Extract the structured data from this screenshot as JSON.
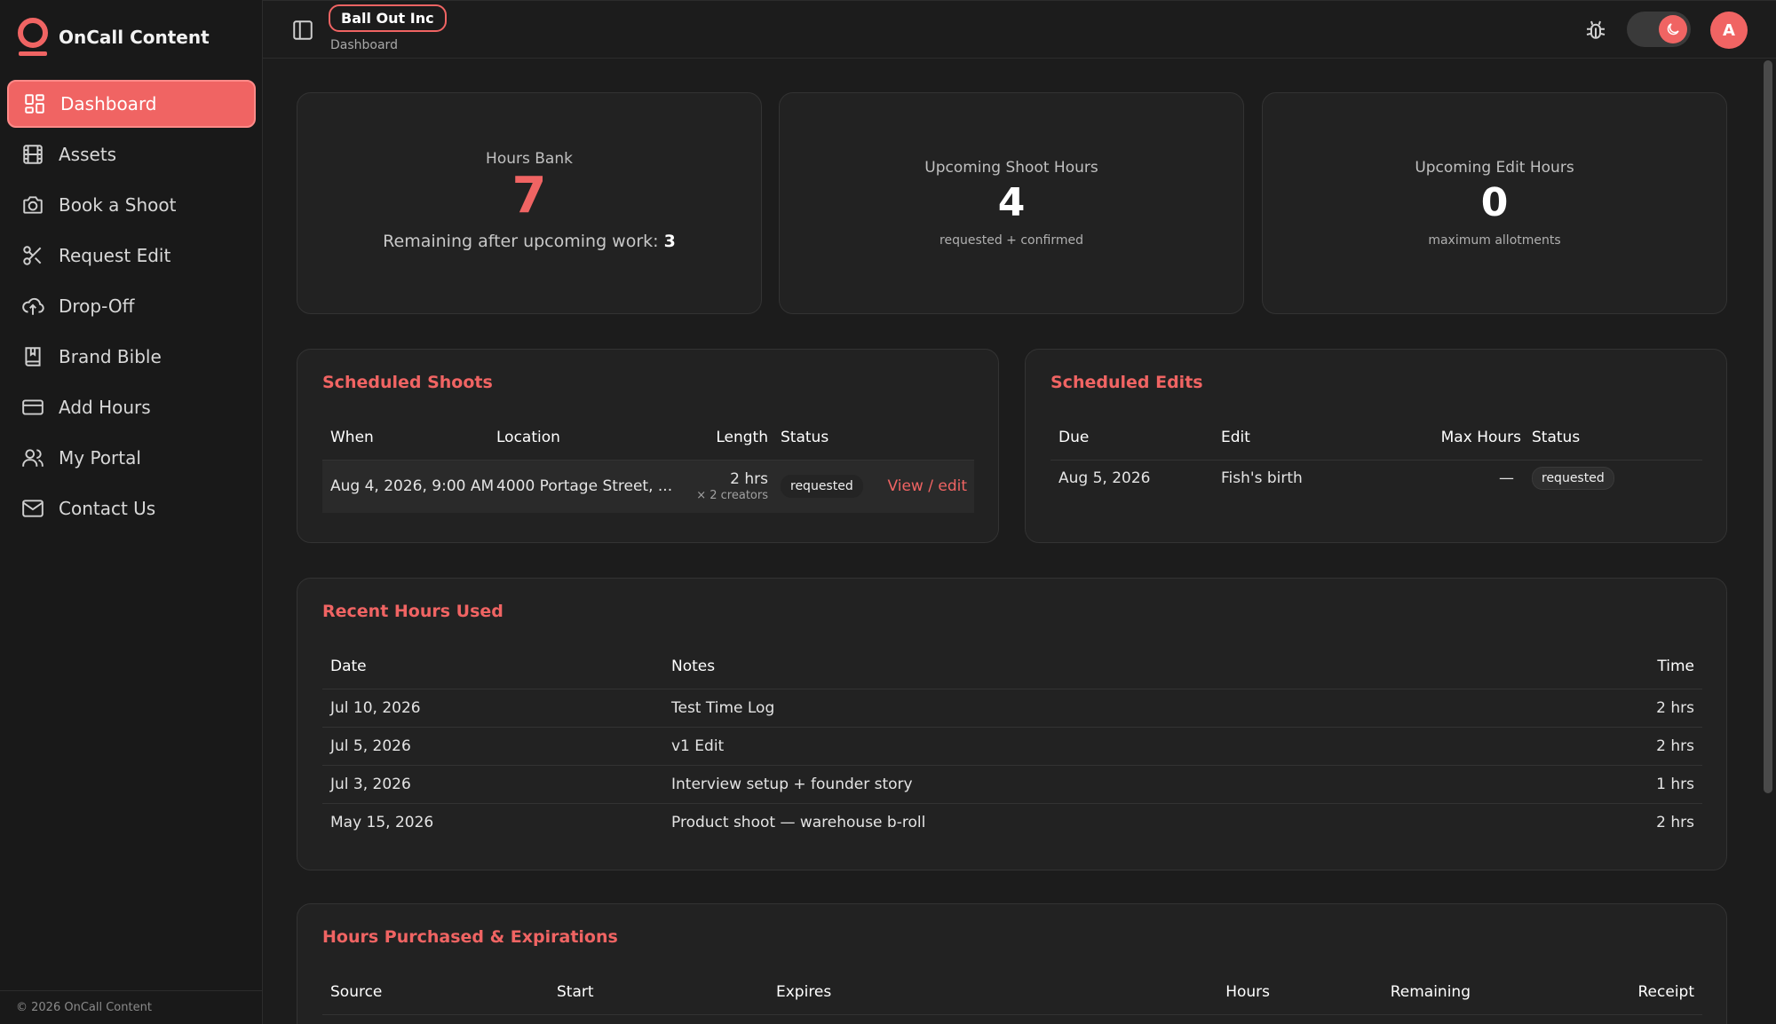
{
  "brand": {
    "name": "OnCall Content",
    "accent": "#f06463"
  },
  "nav": [
    {
      "label": "Dashboard",
      "icon": "dashboard-icon",
      "active": true
    },
    {
      "label": "Assets",
      "icon": "film-icon"
    },
    {
      "label": "Book a Shoot",
      "icon": "camera-icon"
    },
    {
      "label": "Request Edit",
      "icon": "scissors-icon"
    },
    {
      "label": "Drop-Off",
      "icon": "cloud-upload-icon"
    },
    {
      "label": "Brand Bible",
      "icon": "book-icon"
    },
    {
      "label": "Add Hours",
      "icon": "credit-card-icon"
    },
    {
      "label": "My Portal",
      "icon": "users-icon"
    },
    {
      "label": "Contact Us",
      "icon": "mail-icon"
    }
  ],
  "footer": "© 2026 OnCall Content",
  "topbar": {
    "org": "Ball Out Inc",
    "breadcrumb": "Dashboard",
    "avatar_initial": "A"
  },
  "stats": {
    "hours_bank": {
      "label": "Hours Bank",
      "value": "7",
      "sub_prefix": "Remaining after upcoming work:",
      "sub_value": "3"
    },
    "shoot_hours": {
      "label": "Upcoming Shoot Hours",
      "value": "4",
      "sub": "requested + confirmed"
    },
    "edit_hours": {
      "label": "Upcoming Edit Hours",
      "value": "0",
      "sub": "maximum allotments"
    }
  },
  "shoots": {
    "title": "Scheduled Shoots",
    "headers": [
      "When",
      "Location",
      "Length",
      "Status"
    ],
    "rows": [
      {
        "when": "Aug 4, 2026, 9:00 AM",
        "location": "4000 Portage Street, ...",
        "length": "2 hrs",
        "creators": "× 2 creators",
        "status": "requested",
        "action": "View / edit"
      }
    ]
  },
  "edits": {
    "title": "Scheduled Edits",
    "headers": [
      "Due",
      "Edit",
      "Max Hours",
      "Status"
    ],
    "rows": [
      {
        "due": "Aug 5, 2026",
        "edit": "Fish's birth",
        "max": "—",
        "status": "requested"
      }
    ]
  },
  "recent": {
    "title": "Recent Hours Used",
    "headers": [
      "Date",
      "Notes",
      "Time"
    ],
    "rows": [
      {
        "date": "Jul 10, 2026",
        "notes": "Test Time Log",
        "time": "2 hrs"
      },
      {
        "date": "Jul 5, 2026",
        "notes": "v1 Edit",
        "time": "2 hrs"
      },
      {
        "date": "Jul 3, 2026",
        "notes": "Interview setup + founder story",
        "time": "1 hrs"
      },
      {
        "date": "May 15, 2026",
        "notes": "Product shoot — warehouse b-roll",
        "time": "2 hrs"
      }
    ]
  },
  "purchased": {
    "title": "Hours Purchased & Expirations",
    "headers": [
      "Source",
      "Start",
      "Expires",
      "Hours",
      "Remaining",
      "Receipt"
    ]
  }
}
